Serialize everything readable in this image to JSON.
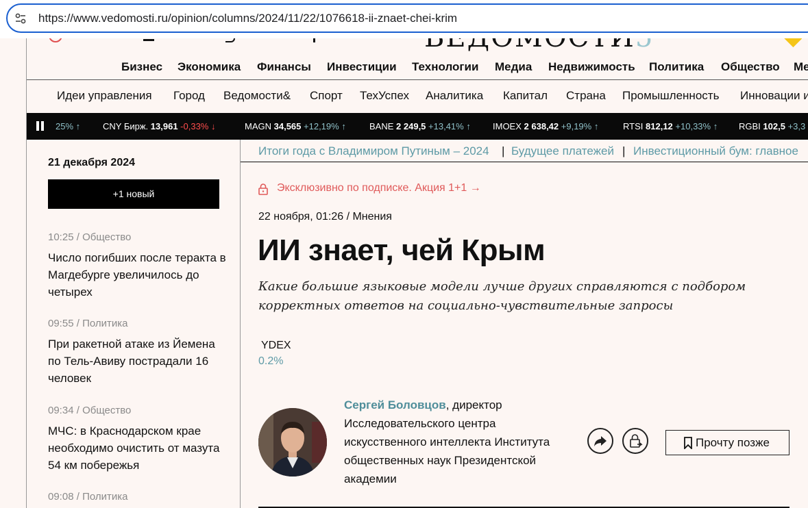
{
  "browser": {
    "url": "https://www.vedomosti.ru/opinion/columns/2024/11/22/1076618-ii-znaet-chei-krim"
  },
  "nav": {
    "main": [
      "Бизнес",
      "Экономика",
      "Финансы",
      "Инвестиции",
      "Технологии",
      "Медиа",
      "Недвижимость",
      "Политика",
      "Общество",
      "Ме"
    ],
    "sub": [
      "Идеи управления",
      "Город",
      "Ведомости&",
      "Спорт",
      "ТехУспех",
      "Аналитика",
      "Капитал",
      "Страна",
      "Промышленность",
      "Инновации и"
    ]
  },
  "ticker": [
    {
      "sym": "",
      "price": "",
      "change": "25%",
      "dir": "up"
    },
    {
      "sym": "CNY Бирж.",
      "price": "13,961",
      "change": "-0,33%",
      "dir": "down"
    },
    {
      "sym": "MAGN",
      "price": "34,565",
      "change": "+12,19%",
      "dir": "up"
    },
    {
      "sym": "BANE",
      "price": "2 249,5",
      "change": "+13,41%",
      "dir": "up"
    },
    {
      "sym": "IMOEX",
      "price": "2 638,42",
      "change": "+9,19%",
      "dir": "up"
    },
    {
      "sym": "RTSI",
      "price": "812,12",
      "change": "+10,33%",
      "dir": "up"
    },
    {
      "sym": "RGBI",
      "price": "102,5",
      "change": "+3,3",
      "dir": "up"
    }
  ],
  "sidebar": {
    "date": "21 декабря 2024",
    "new_button": "+1 новый",
    "news": [
      {
        "time": "10:25",
        "rubric": "Общество",
        "title": "Число погибших после теракта в Магдебурге увеличилось до четырех"
      },
      {
        "time": "09:55",
        "rubric": "Политика",
        "title": "При ракетной атаке из Йемена по Тель-Авиву пострадали 16 человек"
      },
      {
        "time": "09:34",
        "rubric": "Общество",
        "title": "МЧС: в Краснодарском крае необходимо очистить от мазута 54 км побережья"
      },
      {
        "time": "09:08",
        "rubric": "Политика",
        "title": ""
      }
    ]
  },
  "topics": [
    "Итоги года с Владимиром Путиным – 2024",
    "Будущее платежей",
    "Инвестиционный бум: главное"
  ],
  "article": {
    "exclusive": "Эксклюзивно по подписке. Акция 1+1 →",
    "date": "22 ноября, 01:26",
    "rubric": "Мнения",
    "headline": "ИИ знает, чей Крым",
    "lead": "Какие большие языковые модели лучше других справляются с подбором корректных ответов на социально-чувствительные запросы",
    "stock_symbol": "YDEX",
    "stock_change": "0.2%",
    "author_name": "Сергей Боловцов",
    "author_bio": ", директор Исследовательского центра искусственного интеллекта Института общественных наук Президентской академии",
    "read_later": "Прочту позже"
  },
  "colors": {
    "accent": "#5e9aa6",
    "exclusive": "#e05a5a",
    "ticker_bg": "#0a0a0a",
    "up": "#8fc0c8",
    "down": "#ff4d4d"
  }
}
